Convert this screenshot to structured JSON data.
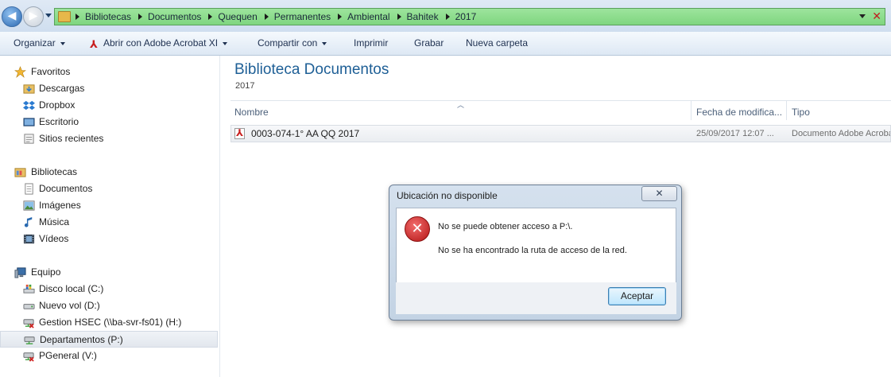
{
  "address": {
    "crumbs": [
      "Bibliotecas",
      "Documentos",
      "Quequen",
      "Permanentes",
      "Ambiental",
      "Bahitek",
      "2017"
    ]
  },
  "toolbar": {
    "organize": "Organizar",
    "open_with": "Abrir con Adobe Acrobat XI",
    "share": "Compartir con",
    "print": "Imprimir",
    "burn": "Grabar",
    "new_folder": "Nueva carpeta"
  },
  "nav": {
    "favorites": {
      "label": "Favoritos",
      "items": [
        "Descargas",
        "Dropbox",
        "Escritorio",
        "Sitios recientes"
      ]
    },
    "libraries": {
      "label": "Bibliotecas",
      "items": [
        "Documentos",
        "Imágenes",
        "Música",
        "Vídeos"
      ]
    },
    "computer": {
      "label": "Equipo",
      "items": [
        "Disco local (C:)",
        "Nuevo vol (D:)",
        "Gestion HSEC (\\\\ba-svr-fs01) (H:)",
        "Departamentos (P:)",
        "PGeneral (V:)"
      ]
    },
    "selected": "Departamentos (P:)"
  },
  "content": {
    "title": "Biblioteca Documentos",
    "subtitle": "2017",
    "columns": [
      "Nombre",
      "Fecha de modifica...",
      "Tipo"
    ],
    "files": [
      {
        "name": "0003-074-1° AA QQ 2017",
        "date": "25/09/2017 12:07 ...",
        "type": "Documento Adobe Acrobat"
      }
    ]
  },
  "dialog": {
    "title": "Ubicación no disponible",
    "close": "✕",
    "message1": "No se puede obtener acceso a P:\\.",
    "message2": "No se ha encontrado la ruta de acceso de la red.",
    "ok": "Aceptar"
  }
}
